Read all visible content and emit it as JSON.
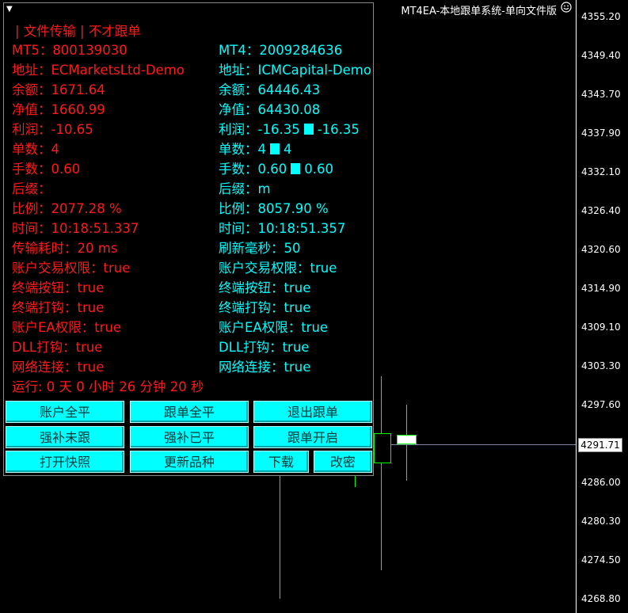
{
  "window_title": "MT4EA-本地跟单系统-单向文件版",
  "icons": {
    "smiley": "smiley-icon",
    "collapse": "collapse-triangle-icon"
  },
  "colors": {
    "red": "#ff1a1a",
    "cyan": "#00ffff",
    "candle": "#00ff00",
    "background": "#000000"
  },
  "price_axis": {
    "labels": [
      "4355.20",
      "4349.40",
      "4343.70",
      "4337.90",
      "4332.10",
      "4326.40",
      "4320.60",
      "4314.90",
      "4309.10",
      "4303.30",
      "4297.60",
      "4286.00",
      "4280.30",
      "4274.50",
      "4268.80"
    ],
    "current": "4291.71"
  },
  "panel": {
    "title": "| 文件传输 | 不才跟单",
    "left": {
      "header": "MT5：800139030",
      "address": "地址：ECMarketsLtd-Demo",
      "balance": "余额：1671.64",
      "equity": "净值：1660.99",
      "profit": "利润：-10.65",
      "orders": "单数：4",
      "lots": "手数：0.60",
      "suffix": "后缀：",
      "ratio": "比例：2077.28 %",
      "time": "时间：10:18:51.337",
      "latency": "传输耗时：20 ms",
      "account_trade": "账户交易权限：true",
      "terminal_button": "终端按钮：true",
      "terminal_check": "终端打钩：true",
      "account_ea": "账户EA权限：true",
      "dll_check": "DLL打钩：true",
      "network": "网络连接：true",
      "runtime": "运行: 0 天 0 小时 26 分钟 20 秒"
    },
    "right": {
      "header": "MT4：2009284636",
      "address": "地址：ICMCapital-Demo",
      "balance": "余额：64446.43",
      "equity": "净值：64430.08",
      "profit_a": "利润：-16.35",
      "profit_b": "-16.35",
      "orders_a": "单数：4",
      "orders_b": "4",
      "lots_a": "手数：0.60",
      "lots_b": "0.60",
      "suffix": "后缀：m",
      "ratio": "比例：8057.90 %",
      "time": "时间：10:18:51.357",
      "refresh": "刷新毫秒：50",
      "account_trade": "账户交易权限：true",
      "terminal_button": "终端按钮：true",
      "terminal_check": "终端打钩：true",
      "account_ea": "账户EA权限：true",
      "dll_check": "DLL打钩：true",
      "network": "网络连接：true"
    },
    "buttons": {
      "close_all_account": "账户全平",
      "close_all_follow": "跟单全平",
      "exit_follow": "退出跟单",
      "force_unfollowed": "强补未跟",
      "force_closed": "强补已平",
      "enable_follow": "跟单开启",
      "open_snapshot": "打开快照",
      "update_symbols": "更新品种",
      "download": "下载",
      "change_password": "改密"
    }
  }
}
